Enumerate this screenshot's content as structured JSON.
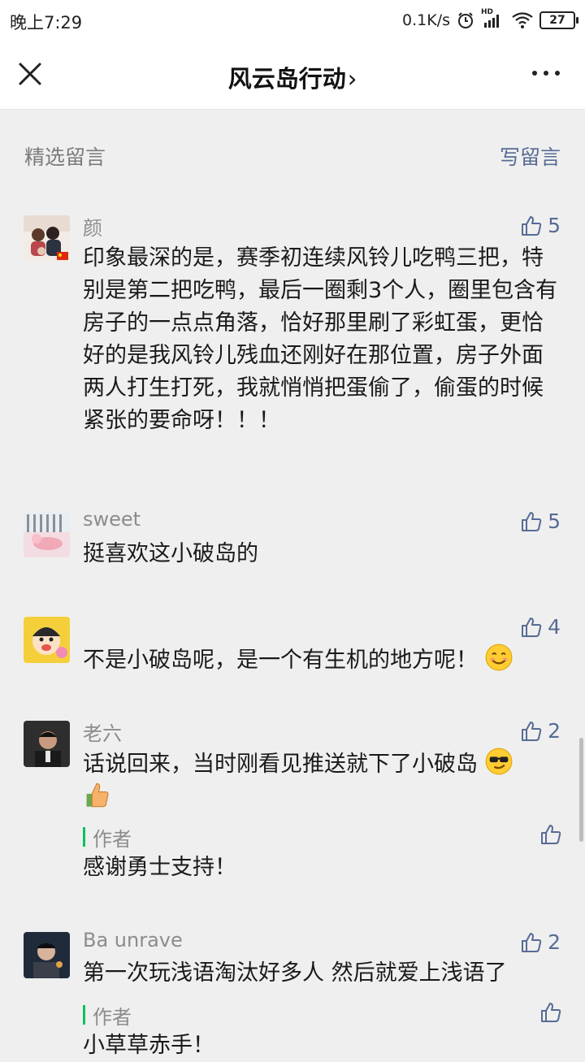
{
  "status_bar": {
    "time": "晚上7:29",
    "speed": "0.1K/s",
    "signal_label": "HD",
    "battery": "27"
  },
  "nav": {
    "title": "风云岛行动",
    "chevron": "›"
  },
  "section": {
    "title": "精选留言",
    "write": "写留言"
  },
  "comments": [
    {
      "nickname": "颜",
      "likes": "5",
      "text": "印象最深的是，赛季初连续风铃儿吃鸭三把，特别是第二把吃鸭，最后一圈剩3个人，圈里包含有房子的一点点角落，恰好那里刷了彩虹蛋，更恰好的是我风铃儿残血还刚好在那位置，房子外面两人打生打死，我就悄悄把蛋偷了，偷蛋的时候紧张的要命呀！！！"
    },
    {
      "nickname": "sweet",
      "likes": "5",
      "text": "挺喜欢这小破岛的"
    },
    {
      "nickname": "",
      "likes": "4",
      "text": "不是小破岛呢，是一个有生机的地方呢！"
    },
    {
      "nickname": "老六",
      "likes": "2",
      "text": "话说回来，当时刚看见推送就下了小破岛",
      "author_label": "作者",
      "reply": "感谢勇士支持！"
    },
    {
      "nickname": "Ba unrave",
      "likes": "2",
      "text": "第一次玩浅语淘汰好多人 然后就爱上浅语了",
      "author_label": "作者",
      "reply": "小草草赤手！"
    }
  ],
  "colors": {
    "link": "#576b95",
    "author_bar": "#07c160",
    "background": "#efefef"
  },
  "icons": [
    "close-icon",
    "more-icon",
    "thumb-up-icon",
    "smile-emoji",
    "cool-emoji",
    "thumbs-up-emoji"
  ]
}
